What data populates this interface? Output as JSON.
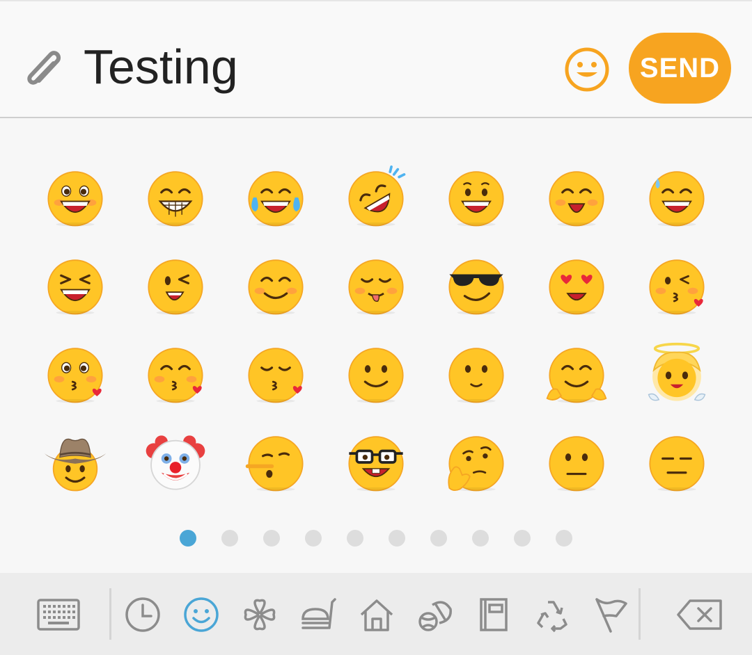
{
  "compose": {
    "message": "Testing",
    "send_label": "SEND"
  },
  "colors": {
    "accent": "#f7a420",
    "active_dot": "#4aa6d6",
    "active_icon": "#4aa6d6",
    "icon_gray": "#8c8c8c"
  },
  "emoji_panel": {
    "rows": [
      [
        "grinning-face-big-eyes",
        "beaming-face",
        "face-with-tears-of-joy",
        "rolling-on-floor-laughing",
        "grinning-face",
        "smiling-face-open-mouth",
        "grinning-face-sweat"
      ],
      [
        "grinning-squinting-face",
        "winking-face",
        "smiling-face-smiling-eyes",
        "face-savoring-food",
        "smiling-face-sunglasses",
        "smiling-face-heart-eyes",
        "face-blowing-kiss"
      ],
      [
        "kissing-face-heart",
        "kissing-face-smiling-eyes",
        "kissing-face-closed-eyes",
        "slightly-smiling-face",
        "smiling-face",
        "hugging-face",
        "smiling-face-halo"
      ],
      [
        "cowboy-hat-face",
        "clown-face",
        "lying-face",
        "nerd-face",
        "thinking-face",
        "neutral-face",
        "expressionless-face"
      ]
    ],
    "page_count": 10,
    "active_page": 1
  },
  "toolbar": {
    "items": [
      {
        "name": "keyboard-icon",
        "active": false
      },
      {
        "name": "recent-clock-icon",
        "active": false
      },
      {
        "name": "smiley-category-icon",
        "active": true
      },
      {
        "name": "clover-category-icon",
        "active": false
      },
      {
        "name": "food-category-icon",
        "active": false
      },
      {
        "name": "house-category-icon",
        "active": false
      },
      {
        "name": "sports-category-icon",
        "active": false
      },
      {
        "name": "objects-category-icon",
        "active": false
      },
      {
        "name": "symbols-recycle-icon",
        "active": false
      },
      {
        "name": "flags-category-icon",
        "active": false
      },
      {
        "name": "backspace-icon",
        "active": false
      }
    ]
  }
}
